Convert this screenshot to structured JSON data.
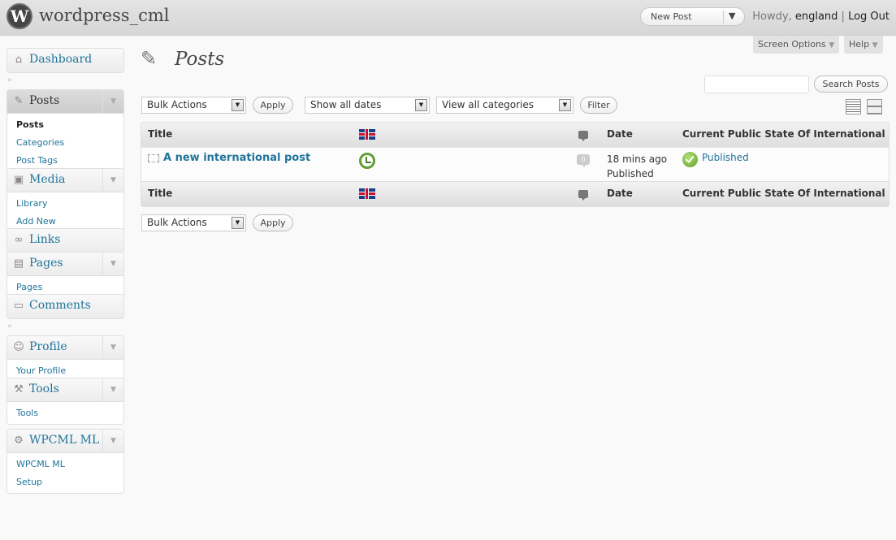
{
  "header": {
    "site_title": "wordpress_cml",
    "new_post": "New Post",
    "howdy": "Howdy,",
    "username": "england",
    "separator": "|",
    "logout": "Log Out",
    "screen_options": "Screen Options",
    "help": "Help"
  },
  "sidebar": {
    "dashboard": "Dashboard",
    "posts": {
      "label": "Posts",
      "items": [
        "Posts",
        "Categories",
        "Post Tags"
      ]
    },
    "media": {
      "label": "Media",
      "items": [
        "Library",
        "Add New"
      ]
    },
    "links": "Links",
    "pages": {
      "label": "Pages",
      "items": [
        "Pages"
      ]
    },
    "comments": "Comments",
    "profile": {
      "label": "Profile",
      "items": [
        "Your Profile"
      ]
    },
    "tools": {
      "label": "Tools",
      "items": [
        "Tools"
      ]
    },
    "wpcml": {
      "label": "WPCML ML",
      "items": [
        "WPCML ML",
        "Setup"
      ]
    }
  },
  "main": {
    "page_title": "Posts",
    "search_button": "Search Posts",
    "search_value": "",
    "bulk_actions": "Bulk Actions",
    "apply": "Apply",
    "dates_filter": "Show all dates",
    "categories_filter": "View all categories",
    "filter": "Filter",
    "columns": {
      "title": "Title",
      "date": "Date",
      "state": "Current Public State Of International"
    },
    "rows": [
      {
        "title": "A new international post",
        "comments": "0",
        "date": "18 mins ago",
        "status": "Published",
        "public_state": "Published"
      }
    ]
  },
  "icons": {
    "flag": "uk-flag-icon",
    "comments": "comment-bubble-icon",
    "translation": "translation-clock-icon",
    "published": "check-icon"
  },
  "colors": {
    "link": "#21759b",
    "header_bg": "#d6d6d6",
    "published_green": "#5e9f22"
  }
}
